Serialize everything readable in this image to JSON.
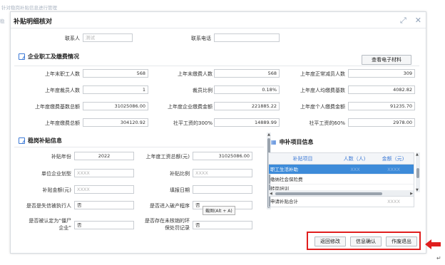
{
  "background": {
    "title": "针对稳岗补贴信息进行管理",
    "side": "稳"
  },
  "dialog": {
    "title": "补贴明细核对",
    "icons": [
      "expand-icon",
      "close-icon"
    ]
  },
  "contact": {
    "label": "联系人",
    "value": "测试",
    "phone_label": "联系电话",
    "phone_value": ""
  },
  "section1": {
    "title": "企业职工及缴费情况",
    "view_button": "查看电子材料",
    "rows": [
      [
        {
          "label": "上年末职工人数",
          "value": "568"
        },
        {
          "label": "上年末缴费人数",
          "value": "568"
        },
        {
          "label": "上年度正常减员人数",
          "value": "309"
        }
      ],
      [
        {
          "label": "上年度裁员人数",
          "value": "1"
        },
        {
          "label": "裁员比例",
          "value": "0.18%"
        },
        {
          "label": "上年度人均缴费基数",
          "value": "4082.82"
        }
      ],
      [
        {
          "label": "上年度缴费基数总额",
          "value": "31025086.00"
        },
        {
          "label": "上年度企业缴费金额",
          "value": "221885.22"
        },
        {
          "label": "上年度个人缴费金额",
          "value": "91235.70"
        }
      ],
      [
        {
          "label": "上年度缴费总额",
          "value": "304120.92"
        },
        {
          "label": "社平工资的300%",
          "value": "14889.99"
        },
        {
          "label": "社平工资的60%",
          "value": "2978.00"
        }
      ]
    ]
  },
  "section2": {
    "title": "稳岗补贴信息",
    "year_label": "补贴年份",
    "year_value": "2022",
    "wage_label": "上年度工资总额(元)",
    "wage_value": "31025086.00",
    "type_label": "单位企业划型",
    "type_placeholder": "XXXX",
    "ratio_label": "补贴比例",
    "ratio_placeholder": "XXXX",
    "amount_label": "补贴金额(元)",
    "amount_placeholder": "XXXX",
    "date_label": "填报日期",
    "date_value": "",
    "q1_label": "是否是失信被执行人",
    "q1_value": "否",
    "q2_label": "是否进入破产程序",
    "q2_value": "否",
    "q3_label_l1": "是否被认定为“僵尸",
    "q3_label_l2": "企业”",
    "q3_value": "否",
    "q4_label_l1": "是否存在未核销的环",
    "q4_label_l2": "保处罚记录",
    "q4_value": "否",
    "tooltip": "截图(Alt + A)"
  },
  "section3": {
    "title": "申补项目信息",
    "headers": [
      "补贴项目",
      "人数（人)",
      "金额（元)"
    ],
    "rows": [
      {
        "item": "职工生活补助",
        "count": "XXX",
        "amount": "XXXX"
      },
      {
        "item": "缴纳社会保险费",
        "count": "",
        "amount": ""
      },
      {
        "item": "转岗培训",
        "count": "",
        "amount": ""
      }
    ],
    "total_label": "申请补贴合计",
    "total_value": "XXXX"
  },
  "footer": {
    "buttons": [
      "返回修改",
      "信息确认",
      "作废退出"
    ]
  },
  "colors": {
    "accent": "#3d7ad6",
    "selected_row": "#3d8bd9",
    "highlight": "#e01e1e"
  }
}
